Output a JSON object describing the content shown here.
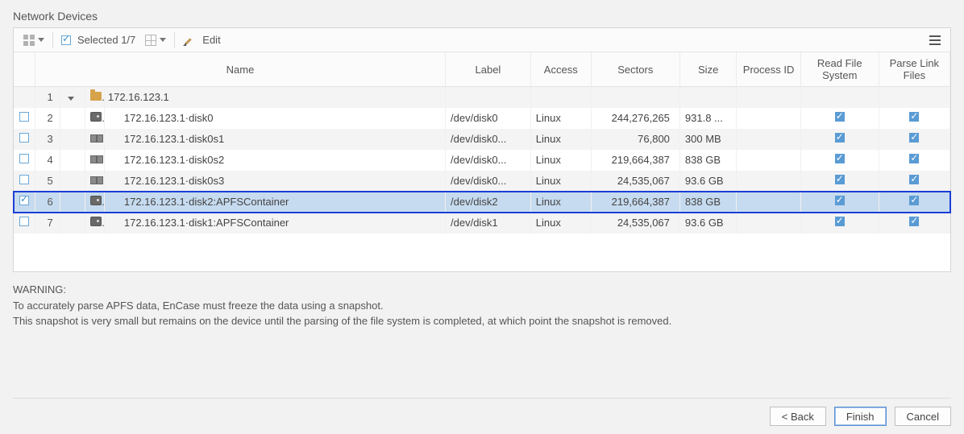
{
  "title": "Network Devices",
  "toolbar": {
    "selected_label": "Selected 1/7",
    "edit_label": "Edit"
  },
  "columns": {
    "name": "Name",
    "label": "Label",
    "access": "Access",
    "sectors": "Sectors",
    "size": "Size",
    "process_id": "Process ID",
    "read_fs": "Read File System",
    "parse_link": "Parse Link Files"
  },
  "rows": [
    {
      "idx": "1",
      "kind": "group",
      "checked": "none",
      "icon": "folder",
      "name": "172.16.123.1",
      "label": "",
      "access": "",
      "sectors": "",
      "size": "",
      "process_id": "",
      "read_fs": "none",
      "parse_link": "none",
      "selected": false
    },
    {
      "idx": "2",
      "kind": "disk",
      "checked": false,
      "icon": "disk",
      "name": "172.16.123.1·disk0",
      "label": "/dev/disk0",
      "access": "Linux",
      "sectors": "244,276,265",
      "size": "931.8 ...",
      "process_id": "",
      "read_fs": true,
      "parse_link": true,
      "selected": false
    },
    {
      "idx": "3",
      "kind": "part",
      "checked": false,
      "icon": "part",
      "name": "172.16.123.1·disk0s1",
      "label": "/dev/disk0...",
      "access": "Linux",
      "sectors": "76,800",
      "size": "300 MB",
      "process_id": "",
      "read_fs": true,
      "parse_link": true,
      "selected": false
    },
    {
      "idx": "4",
      "kind": "part",
      "checked": false,
      "icon": "part",
      "name": "172.16.123.1·disk0s2",
      "label": "/dev/disk0...",
      "access": "Linux",
      "sectors": "219,664,387",
      "size": "838 GB",
      "process_id": "",
      "read_fs": true,
      "parse_link": true,
      "selected": false
    },
    {
      "idx": "5",
      "kind": "part",
      "checked": false,
      "icon": "part",
      "name": "172.16.123.1·disk0s3",
      "label": "/dev/disk0...",
      "access": "Linux",
      "sectors": "24,535,067",
      "size": "93.6 GB",
      "process_id": "",
      "read_fs": true,
      "parse_link": true,
      "selected": false
    },
    {
      "idx": "6",
      "kind": "disk",
      "checked": true,
      "icon": "disk",
      "name": "172.16.123.1·disk2:APFSContainer",
      "label": "/dev/disk2",
      "access": "Linux",
      "sectors": "219,664,387",
      "size": "838 GB",
      "process_id": "",
      "read_fs": true,
      "parse_link": true,
      "selected": true
    },
    {
      "idx": "7",
      "kind": "disk",
      "checked": false,
      "icon": "disk",
      "name": "172.16.123.1·disk1:APFSContainer",
      "label": "/dev/disk1",
      "access": "Linux",
      "sectors": "24,535,067",
      "size": "93.6 GB",
      "process_id": "",
      "read_fs": true,
      "parse_link": true,
      "selected": false
    }
  ],
  "warning": {
    "heading": "WARNING:",
    "line1": "To accurately parse APFS data, EnCase must freeze the data using a snapshot.",
    "line2": "This snapshot is very small but remains on the device until the parsing of the file system is completed, at which point the snapshot is removed."
  },
  "buttons": {
    "back": "< Back",
    "finish": "Finish",
    "cancel": "Cancel"
  }
}
